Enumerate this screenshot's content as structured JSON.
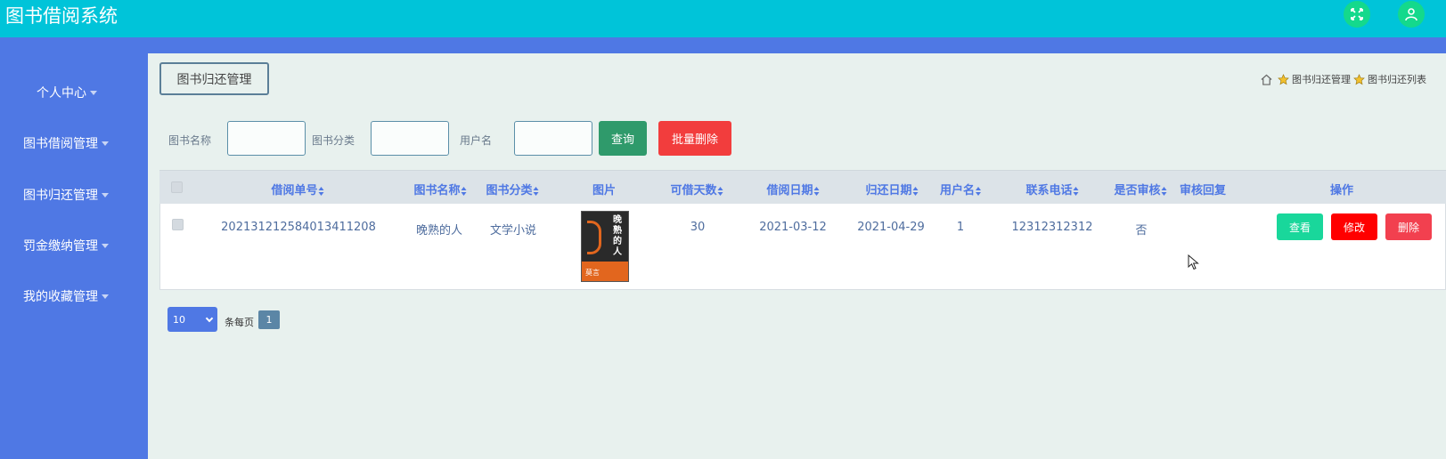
{
  "app": {
    "title": "图书借阅系统"
  },
  "header_icons": [
    "fullscreen-icon",
    "user-icon"
  ],
  "colors": {
    "topbar": "#00c4d9",
    "sidebar": "#4f78e4",
    "query": "#2f9a6b",
    "danger": "#f23d3d",
    "view": "#19d79b",
    "edit": "#ff0000"
  },
  "sidebar": {
    "items": [
      {
        "label": "个人中心"
      },
      {
        "label": "图书借阅管理"
      },
      {
        "label": "图书归还管理"
      },
      {
        "label": "罚金缴纳管理"
      },
      {
        "label": "我的收藏管理"
      }
    ]
  },
  "page": {
    "tab_label": "图书归还管理",
    "breadcrumb": [
      "图书归还管理",
      "图书归还列表"
    ]
  },
  "filters": {
    "book_name_label": "图书名称",
    "book_name_value": "",
    "category_label": "图书分类",
    "category_value": "",
    "username_label": "用户名",
    "username_value": "",
    "query_button": "查询",
    "batch_delete_button": "批量删除"
  },
  "table": {
    "columns": [
      "借阅单号",
      "图书名称",
      "图书分类",
      "图片",
      "可借天数",
      "借阅日期",
      "归还日期",
      "用户名",
      "联系电话",
      "是否审核",
      "审核回复",
      "操作"
    ],
    "rows": [
      {
        "borrow_no": "20213121258401341​1208",
        "book_name": "晚熟的人",
        "category": "文学小说",
        "days": "30",
        "borrow_date": "2021-03-12",
        "return_date": "2021-04-29",
        "username": "1",
        "phone": "12312312312",
        "reviewed": "否",
        "reply": "",
        "cover_title": "晚熟的人",
        "cover_author": "莫言"
      }
    ],
    "actions": {
      "view": "查看",
      "edit": "修改",
      "delete": "删除"
    }
  },
  "pagination": {
    "page_size": "10",
    "per_page_label": "条每页",
    "current_page": "1"
  }
}
